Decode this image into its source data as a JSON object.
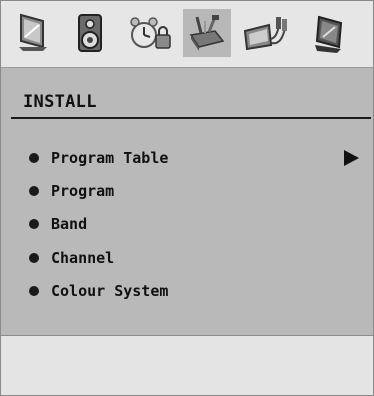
{
  "tabs": [
    {
      "icon": "tv-picture-icon",
      "active": false
    },
    {
      "icon": "speaker-icon",
      "active": false
    },
    {
      "icon": "alarm-clock-lock-icon",
      "active": false
    },
    {
      "icon": "toolbox-icon",
      "active": true
    },
    {
      "icon": "cable-connector-icon",
      "active": false
    },
    {
      "icon": "monitor-source-icon",
      "active": false
    }
  ],
  "menu": {
    "title": "INSTALL",
    "items": [
      {
        "label": "Program Table",
        "has_submenu": true
      },
      {
        "label": "Program",
        "has_submenu": false
      },
      {
        "label": "Band",
        "has_submenu": false
      },
      {
        "label": "Channel",
        "has_submenu": false
      },
      {
        "label": "Colour System",
        "has_submenu": false
      }
    ]
  },
  "colors": {
    "panel": "#b9b9b9",
    "iconbar": "#e6e6e6",
    "active_tab": "#b8b8b8",
    "text": "#111111"
  }
}
